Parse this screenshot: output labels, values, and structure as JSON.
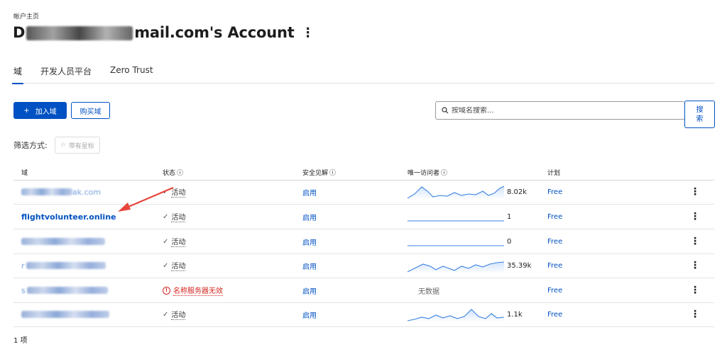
{
  "breadcrumb": "帐户主页",
  "page_title": "D       mail.com's Account",
  "page_title_visible_suffix": "mail.com's Account",
  "page_title_prefix_visible": "D",
  "tabs": [
    {
      "label": "域",
      "active": true
    },
    {
      "label": "开发人员平台",
      "active": false
    },
    {
      "label": "Zero Trust",
      "active": false
    }
  ],
  "actions": {
    "add_domain_label": "加入域",
    "buy_domain_label": "购买域"
  },
  "search": {
    "placeholder": "按域名搜索...",
    "button_label": "搜索"
  },
  "filter": {
    "label": "筛选方式:",
    "starred_label": "带有星标"
  },
  "table": {
    "headers": {
      "domain": "域",
      "status": "状态",
      "security": "安全见解",
      "visitors": "唯一访问者",
      "plan": "计划"
    },
    "rows": [
      {
        "domain_visible": "ak.com",
        "status": "活动",
        "status_type": "ok",
        "security": "启用",
        "visitors": "8.02k",
        "plan": "Free"
      },
      {
        "domain_visible": "flightvolunteer.online",
        "status": "活动",
        "status_type": "ok",
        "security": "启用",
        "visitors": "1",
        "plan": "Free"
      },
      {
        "domain_visible": "",
        "status": "活动",
        "status_type": "ok",
        "security": "启用",
        "visitors": "0",
        "plan": "Free"
      },
      {
        "domain_visible": "r",
        "status": "活动",
        "status_type": "ok",
        "security": "启用",
        "visitors": "35.39k",
        "plan": "Free"
      },
      {
        "domain_visible": "s",
        "status": "名称服务器无效",
        "status_type": "error",
        "security": "启用",
        "visitors": "无数据",
        "plan": "Free"
      },
      {
        "domain_visible": "",
        "status": "活动",
        "status_type": "ok",
        "security": "启用",
        "visitors": "1.1k",
        "plan": "Free"
      }
    ]
  },
  "count_label": "1 项",
  "colors": {
    "accent": "#0051c3",
    "error": "#d4231e",
    "arrow": "#e8453c"
  }
}
